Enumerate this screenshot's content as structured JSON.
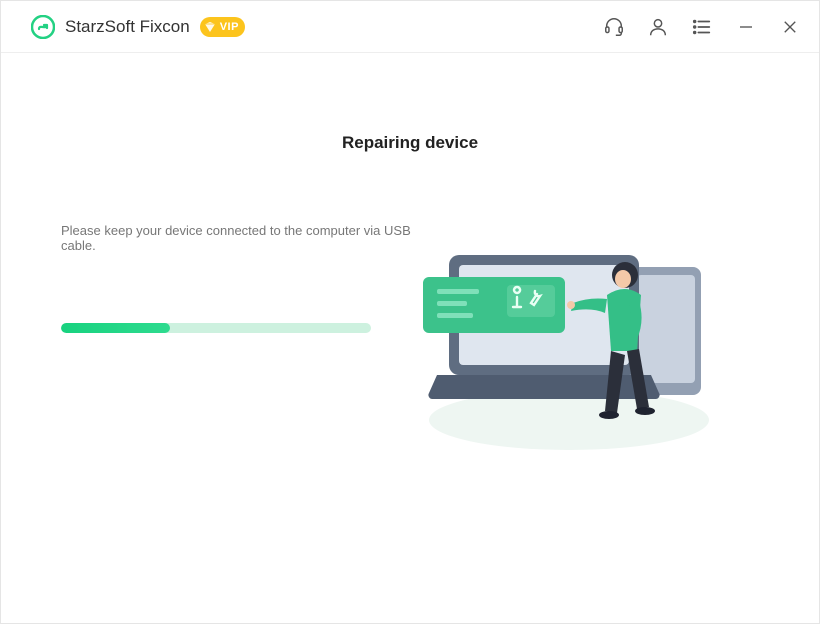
{
  "header": {
    "app_title": "StarzSoft Fixcon",
    "vip_label": "VIP"
  },
  "main": {
    "heading": "Repairing device",
    "instruction": "Please keep your device connected to the computer via USB cable.",
    "progress_percent": 35
  },
  "colors": {
    "accent": "#23d183",
    "vip_badge": "#fcc41d"
  }
}
